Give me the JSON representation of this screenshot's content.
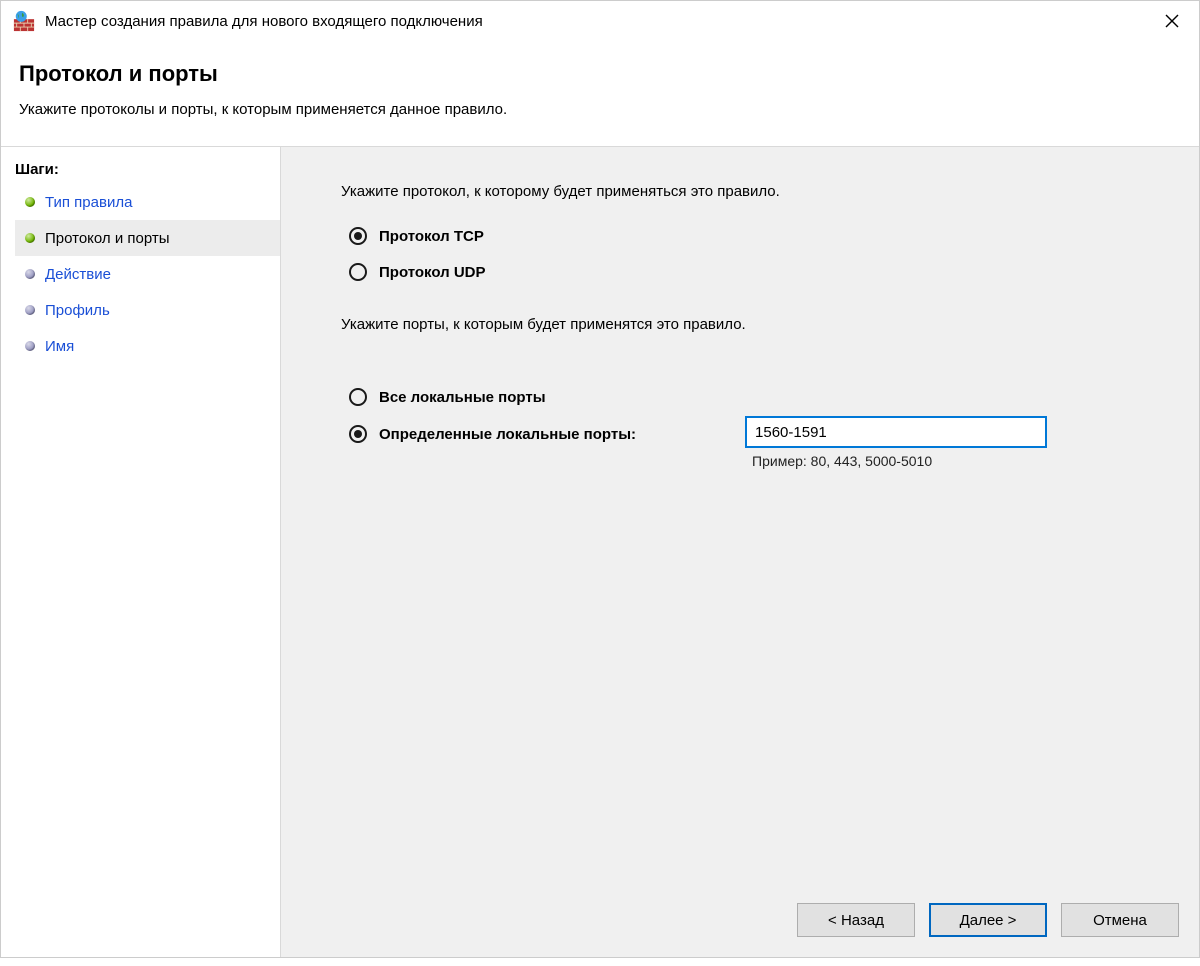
{
  "window_title": "Мастер создания правила для нового входящего подключения",
  "header": {
    "title": "Протокол и порты",
    "subtitle": "Укажите протоколы и порты, к которым применяется данное правило."
  },
  "sidebar": {
    "heading": "Шаги:",
    "steps": [
      {
        "label": "Тип правила",
        "state": "done",
        "bullet": "green"
      },
      {
        "label": "Протокол и порты",
        "state": "active",
        "bullet": "green"
      },
      {
        "label": "Действие",
        "state": "pending",
        "bullet": "gray"
      },
      {
        "label": "Профиль",
        "state": "pending",
        "bullet": "gray"
      },
      {
        "label": "Имя",
        "state": "pending",
        "bullet": "gray"
      }
    ]
  },
  "main": {
    "protocol_instruction": "Укажите протокол, к которому будет применяться это правило.",
    "protocol_options": {
      "tcp": "Протокол TCP",
      "udp": "Протокол UDP",
      "selected": "tcp"
    },
    "ports_instruction": "Укажите порты, к которым будет применятся это правило.",
    "port_options": {
      "all": "Все локальные порты",
      "specific": "Определенные локальные порты:",
      "selected": "specific"
    },
    "port_input_value": "1560-1591",
    "port_example": "Пример: 80, 443, 5000-5010"
  },
  "footer": {
    "back": "< Назад",
    "next": "Далее >",
    "cancel": "Отмена"
  }
}
